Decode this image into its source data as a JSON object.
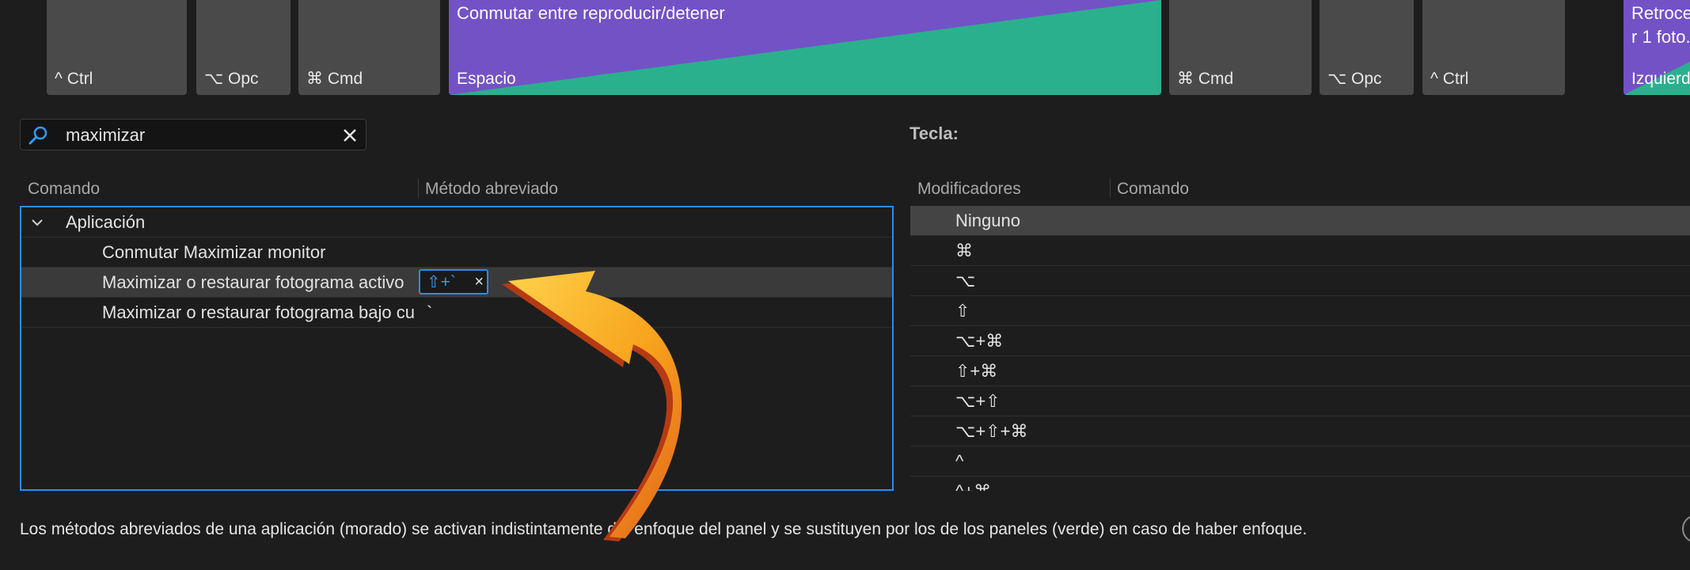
{
  "keyboard": {
    "keys": [
      {
        "label": "^ Ctrl"
      },
      {
        "label": "⌥ Opc"
      },
      {
        "label": "⌘ Cmd"
      },
      {
        "label": "Espacio",
        "command": "Conmutar entre reproducir/detener"
      },
      {
        "label": "⌘ Cmd"
      },
      {
        "label": "⌥ Opc"
      },
      {
        "label": "^ Ctrl"
      },
      {
        "label": "Izquierd",
        "command": "Retroce\nr 1 foto."
      }
    ],
    "colors": {
      "application": "#7352c6",
      "panel": "#2bb08e",
      "key": "#4a4a4a"
    }
  },
  "search": {
    "value": "maximizar"
  },
  "tecla_label": "Tecla:",
  "command_list": {
    "headers": {
      "command": "Comando",
      "shortcut": "Método abreviado"
    },
    "group": "Aplicación",
    "rows": [
      {
        "command": "Conmutar Maximizar monitor",
        "shortcut": ""
      },
      {
        "command": "Maximizar o restaurar fotograma activo",
        "shortcut": "⇧+`"
      },
      {
        "command": "Maximizar o restaurar fotograma bajo cu",
        "shortcut": "`"
      }
    ]
  },
  "modifiers": {
    "headers": {
      "modifiers": "Modificadores",
      "command": "Comando"
    },
    "rows": [
      "Ninguno",
      "⌘",
      "⌥",
      "⇧",
      "⌥+⌘",
      "⇧+⌘",
      "⌥+⇧",
      "⌥+⇧+⌘",
      "^",
      "^+⌘"
    ]
  },
  "footer_text": "Los métodos abreviados de una aplicación (morado) se activan indistintamente del enfoque del panel y se sustituyen por los de los paneles (verde) en caso de haber enfoque."
}
